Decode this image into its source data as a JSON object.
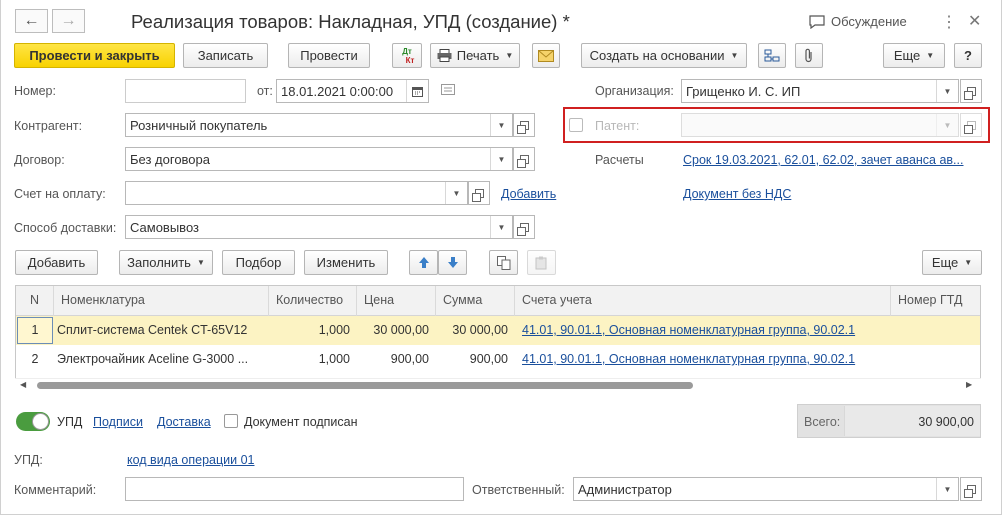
{
  "window": {
    "title": "Реализация товаров: Накладная, УПД (создание) *",
    "discuss_label": "Обсуждение"
  },
  "toolbar": {
    "post_close": "Провести и закрыть",
    "save": "Записать",
    "post": "Провести",
    "dtkt_top": "Дт",
    "dtkt_bottom": "Кт",
    "print": "Печать",
    "create_based": "Создать на основании",
    "more": "Еще",
    "help": "?"
  },
  "form": {
    "number_label": "Номер:",
    "number_value": "",
    "date_label": "от:",
    "date_value": "18.01.2021  0:00:00",
    "org_label": "Организация:",
    "org_value": "Грищенко И. С. ИП",
    "counterparty_label": "Контрагент:",
    "counterparty_value": "Розничный покупатель",
    "patent_label": "Патент:",
    "contract_label": "Договор:",
    "contract_value": "Без договора",
    "settlements_label": "Расчеты",
    "settlements_link": "Срок 19.03.2021, 62.01, 62.02, зачет аванса ав...",
    "invoice_label": "Счет на оплату:",
    "invoice_value": "",
    "add_link": "Добавить",
    "vat_link": "Документ без НДС",
    "delivery_label": "Способ доставки:",
    "delivery_value": "Самовывоз"
  },
  "table_toolbar": {
    "add": "Добавить",
    "fill": "Заполнить",
    "pick": "Подбор",
    "edit": "Изменить",
    "more": "Еще"
  },
  "table": {
    "columns": [
      "N",
      "Номенклатура",
      "Количество",
      "Цена",
      "Сумма",
      "Счета учета",
      "Номер ГТД"
    ],
    "rows": [
      {
        "n": "1",
        "item": "Сплит-система Centek CT-65V12",
        "qty": "1,000",
        "price": "30 000,00",
        "sum": "30 000,00",
        "accounts": "41.01, 90.01.1, Основная номенклатурная группа, 90.02.1",
        "gtd": ""
      },
      {
        "n": "2",
        "item": "Электрочайник Aceline G-3000 ...",
        "qty": "1,000",
        "price": "900,00",
        "sum": "900,00",
        "accounts": "41.01, 90.01.1, Основная номенклатурная группа, 90.02.1",
        "gtd": ""
      }
    ]
  },
  "footer": {
    "upd_toggle_label": "УПД",
    "signatures_link": "Подписи",
    "delivery_link": "Доставка",
    "doc_signed_label": "Документ подписан",
    "total_label": "Всего:",
    "total_value": "30 900,00",
    "upd_label": "УПД:",
    "op_code_link": "код вида операции 01",
    "comment_label": "Комментарий:",
    "comment_value": "",
    "responsible_label": "Ответственный:",
    "responsible_value": "Администратор"
  },
  "colors": {
    "primary_button": "#f8d200",
    "link": "#1a4f9c",
    "highlight_box": "#d02020",
    "selected_row": "#fcf3c3",
    "toggle_on": "#4a9c3f"
  }
}
